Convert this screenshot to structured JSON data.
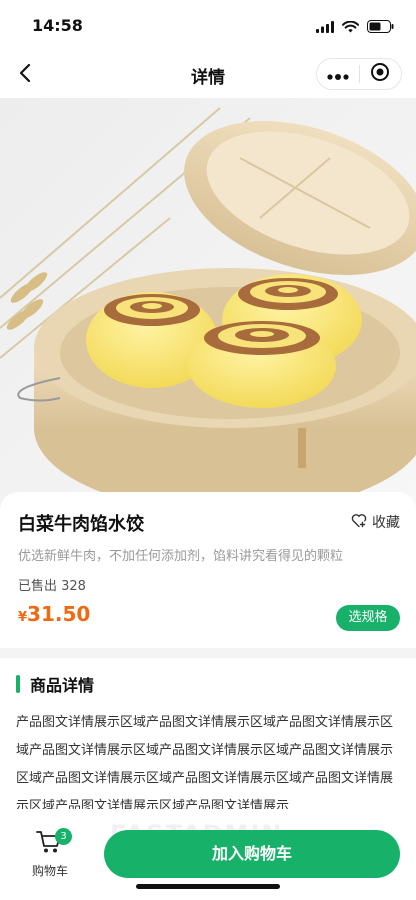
{
  "status_bar": {
    "time": "14:58"
  },
  "nav": {
    "title": "详情"
  },
  "product": {
    "name": "白菜牛肉馅水饺",
    "favorite_label": "收藏",
    "subtitle": "优选新鲜牛肉，不加任何添加剂，馅料讲究看得见的颗粒",
    "sold_label": "已售出 328",
    "currency": "¥",
    "price": "31.50",
    "spec_button": "选规格"
  },
  "detail": {
    "title": "商品详情",
    "content": "产品图文详情展示区域产品图文详情展示区域产品图文详情展示区域产品图文详情展示区域产品图文详情展示区域产品图文详情展示区域产品图文详情展示区域产品图文详情展示区域产品图文详情展示区域产品图文详情展示区域产品图文详情展示"
  },
  "bottom": {
    "cart_label": "购物车",
    "cart_count": "3",
    "add_to_cart": "加入购物车",
    "watermark": "FASTADMIN"
  },
  "colors": {
    "accent": "#18b16a",
    "price": "#f06a14",
    "muted": "#9a9a9a"
  },
  "icons": [
    "back-arrow-icon",
    "more-dots-icon",
    "target-circle-icon",
    "heart-plus-icon",
    "cart-icon",
    "signal-icon",
    "wifi-icon",
    "battery-icon"
  ]
}
